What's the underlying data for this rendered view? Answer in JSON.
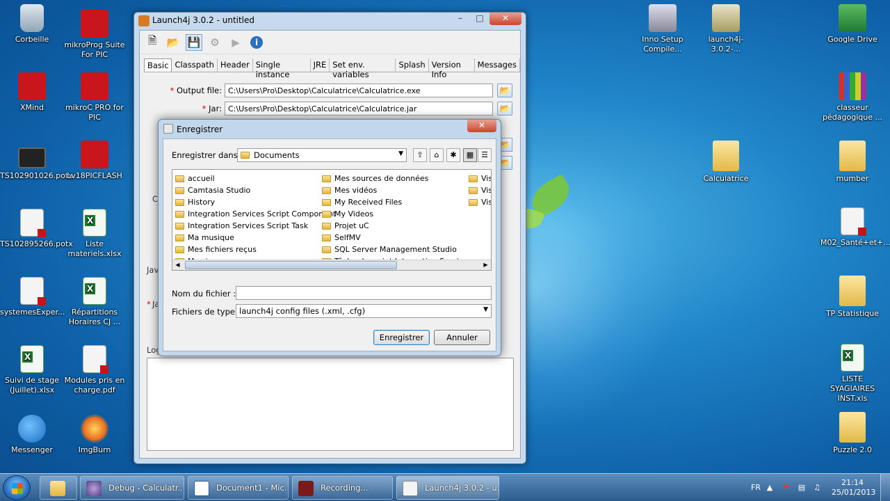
{
  "desktop": {
    "icons": [
      {
        "label": "Corbeille"
      },
      {
        "label": "mikroProg Suite For PIC"
      },
      {
        "label": "XMind"
      },
      {
        "label": "mikroC PRO for PIC"
      },
      {
        "label": "TS102901026.potx"
      },
      {
        "label": "Lv18PICFLASH"
      },
      {
        "label": "TS102895266.potx"
      },
      {
        "label": "Liste materiels.xlsx"
      },
      {
        "label": "systemesExper..."
      },
      {
        "label": "Répartitions Horaires CJ ..."
      },
      {
        "label": "Suivi de stage (Juillet).xlsx"
      },
      {
        "label": "Modules pris en charge.pdf"
      },
      {
        "label": "Messenger"
      },
      {
        "label": "ImgBurn"
      },
      {
        "label": "Inno Setup Compile..."
      },
      {
        "label": "launch4j-3.0.2-..."
      },
      {
        "label": "Google Drive"
      },
      {
        "label": "classeur pédagogique ..."
      },
      {
        "label": "Calculatrice"
      },
      {
        "label": "mumber"
      },
      {
        "label": "M02_Santé+et+..."
      },
      {
        "label": "TP Statistique"
      },
      {
        "label": "LISTE SYAGIAIRES INST.xls"
      },
      {
        "label": "Puzzle 2.0"
      }
    ]
  },
  "launch4j": {
    "title": "Launch4j 3.0.2 - untitled",
    "tabs": [
      "Basic",
      "Classpath",
      "Header",
      "Single instance",
      "JRE",
      "Set env. variables",
      "Splash",
      "Version Info",
      "Messages"
    ],
    "output_label": "Output file:",
    "output_value": "C:\\Users\\Pro\\Desktop\\Calculatrice\\Calculatrice.exe",
    "jar_label": "Jar:",
    "jar_value": "C:\\Users\\Pro\\Desktop\\Calculatrice\\Calculatrice.jar",
    "required_mark": "*",
    "partial_labels": {
      "c": "C",
      "java": "Jav",
      "ja": "Ja",
      "log": "Log"
    }
  },
  "dialog": {
    "title": "Enregistrer",
    "lookin_label": "Enregistrer dans :",
    "lookin_value": "Documents",
    "col1": [
      "accueil",
      "Camtasia Studio",
      "History",
      "Integration Services Script Component",
      "Integration Services Script Task",
      "Ma musique",
      "Mes fichiers reçus",
      "Mes images"
    ],
    "col2": [
      "Mes sources de données",
      "Mes vidéos",
      "My Received Files",
      "My Videos",
      "Projet uC",
      "SelfMV",
      "SQL Server Management Studio",
      "Tâche de script Integration Services"
    ],
    "col3": [
      "Vis",
      "Vis",
      "Vis"
    ],
    "filename_label": "Nom du fichier :",
    "filename_value": "",
    "filetype_label": "Fichiers de type :",
    "filetype_value": "launch4j config files (.xml, .cfg)",
    "save_label": "Enregistrer",
    "cancel_label": "Annuler"
  },
  "taskbar": {
    "items": [
      "Debug - Calculatr...",
      "Document1 - Mic...",
      "Recording...",
      "Launch4j 3.0.2 - u..."
    ],
    "lang": "FR",
    "time": "21:14",
    "date": "25/01/2013"
  },
  "colors": {
    "accent": "#3c7fb1",
    "close": "#c84630"
  }
}
